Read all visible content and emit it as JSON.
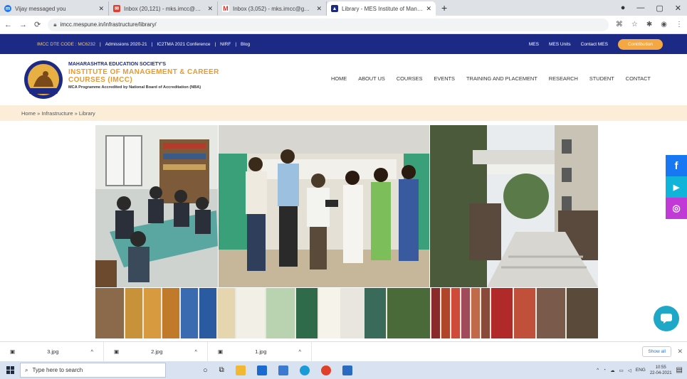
{
  "browser": {
    "tabs": [
      {
        "label": "Vijay messaged you",
        "icon": "messenger-icon",
        "color": "#1877f2"
      },
      {
        "label": "Inbox (20,121) - mks.imcc@mes…",
        "icon": "yahoo-mail-icon",
        "color": "#e03f2e"
      },
      {
        "label": "Inbox (3,052) - mks.imcc@gmail…",
        "icon": "gmail-icon",
        "color": "#d93025"
      },
      {
        "label": "Library - MES Institute of Manag…",
        "icon": "site-icon",
        "color": "#1c2a86",
        "active": true
      }
    ],
    "new_tab": "+",
    "url": "imcc.mespune.in/infrastructure/library/"
  },
  "topstrip": {
    "dte_code": "IMCC DTE CODE : MC6232",
    "links": [
      "Admissions 2020-21",
      "IC2TMA 2021 Conference",
      "NIRF",
      "Blog"
    ],
    "separator": "|",
    "right_links": [
      "MES",
      "MES Units",
      "Contact MES"
    ],
    "contribution": "Contribution"
  },
  "brand": {
    "society": "MAHARASHTRA EDUCATION SOCIETY'S",
    "name_line1": "INSTITUTE OF MANAGEMENT & CAREER",
    "name_line2": "COURSES (IMCC)",
    "accreditation": "MCA Programme Accredited by National Board of Accreditation (NBA)"
  },
  "nav": [
    "HOME",
    "ABOUT US",
    "COURSES",
    "EVENTS",
    "TRAINING AND PLACEMENT",
    "RESEARCH",
    "STUDENT",
    "CONTACT"
  ],
  "breadcrumb": "Home » Infrastructure » Library",
  "downloads": {
    "items": [
      "3.jpg",
      "2.jpg",
      "1.jpg"
    ],
    "show_all": "Show all",
    "chevron": "^",
    "close": "✕"
  },
  "taskbar": {
    "search_placeholder": "Type here to search",
    "lang": "ENG",
    "time": "10:55",
    "date": "22-04-2021"
  },
  "colors": {
    "primary": "#1c2a86",
    "accent": "#e89a2e",
    "breadcrumb_bg": "#fbedd8",
    "facebook": "#1877f2",
    "youtube": "#0fb4d8",
    "instagram": "#c13ad8",
    "chat": "#1fa7c7"
  }
}
